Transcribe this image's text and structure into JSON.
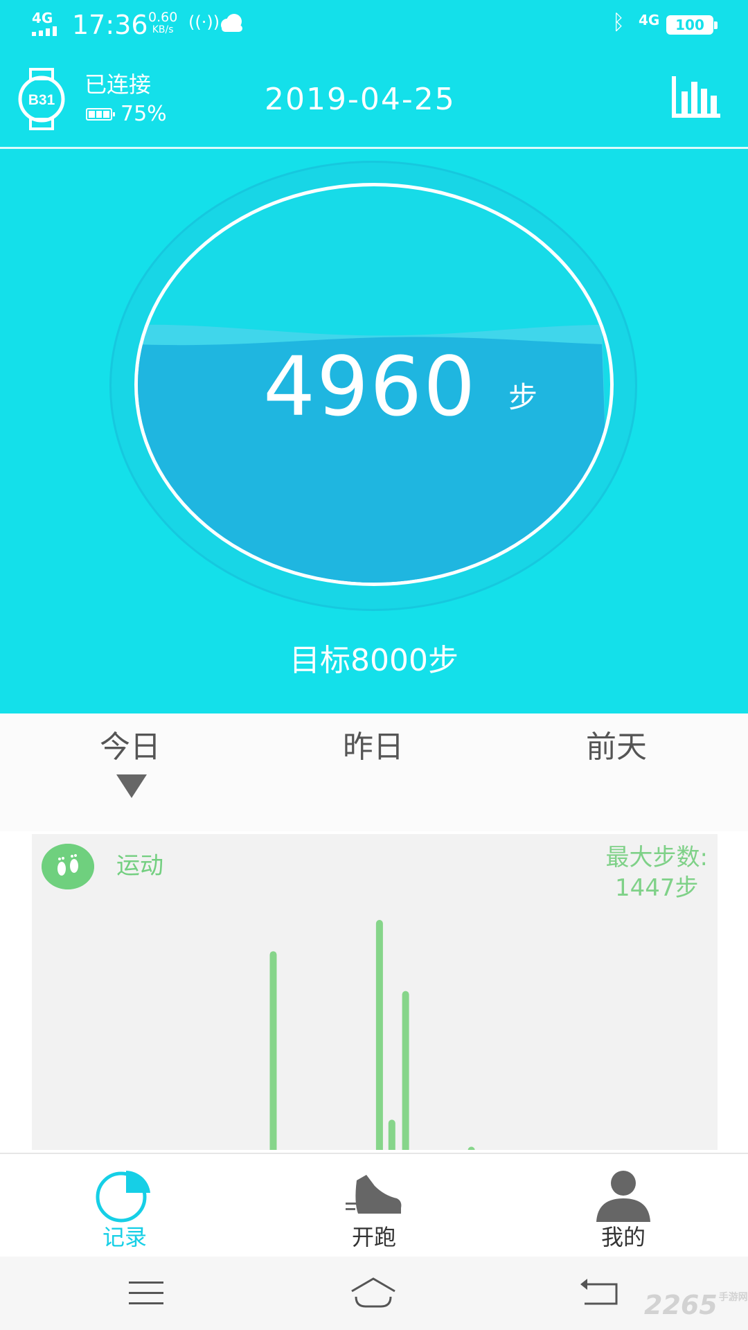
{
  "status_bar": {
    "network": "4G",
    "time": "17:36",
    "speed_value": "0.60",
    "speed_unit": "KB/s",
    "network_right": "4G",
    "battery": "100"
  },
  "header": {
    "device_label": "B31",
    "connection_status": "已连接",
    "device_battery": "75%",
    "date": "2019-04-25"
  },
  "progress": {
    "steps": "4960",
    "unit": "步",
    "goal_text": "目标8000步",
    "goal": 8000,
    "current": 4960
  },
  "day_tabs": {
    "items": [
      {
        "label": "今日"
      },
      {
        "label": "昨日"
      },
      {
        "label": "前天"
      }
    ],
    "selected_index": 0
  },
  "activity": {
    "title": "运动",
    "max_label": "最大步数:",
    "max_value": "1447步",
    "bar_color": "#86d58a"
  },
  "chart_data": {
    "type": "bar",
    "title": "",
    "xlabel": "",
    "ylabel": "",
    "ymax": 1447,
    "bars": [
      {
        "x": 0.352,
        "value": 1250
      },
      {
        "x": 0.507,
        "value": 1447
      },
      {
        "x": 0.525,
        "value": 190
      },
      {
        "x": 0.545,
        "value": 1000
      },
      {
        "x": 0.641,
        "value": 20
      }
    ]
  },
  "bottom_nav": {
    "items": [
      {
        "label": "记录",
        "icon": "pie-chart-icon",
        "active": true
      },
      {
        "label": "开跑",
        "icon": "running-shoe-icon",
        "active": false
      },
      {
        "label": "我的",
        "icon": "person-icon",
        "active": false
      }
    ]
  },
  "colors": {
    "primary": "#14e0ea",
    "water": "#1fb6e0",
    "active_nav": "#16cfe6",
    "inactive_nav": "#666666",
    "green": "#6fd07e"
  },
  "watermark": {
    "brand": "2265",
    "suffix": "手游网"
  }
}
